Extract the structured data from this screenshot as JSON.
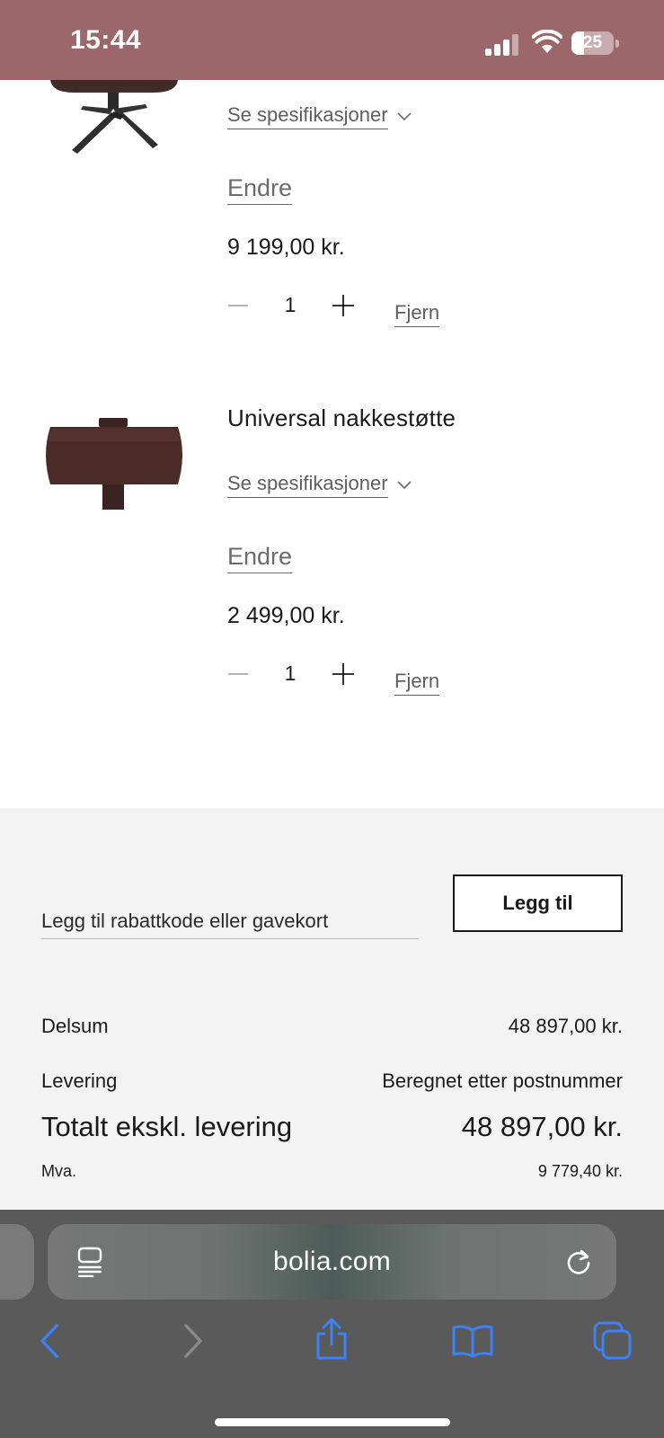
{
  "status_bar": {
    "time": "15:44",
    "battery_level": "25",
    "background_color": "#9b676a"
  },
  "cart": {
    "items": [
      {
        "name": "",
        "spec_label": "Se spesifikasjoner",
        "edit_label": "Endre",
        "price": "9 199,00 kr.",
        "quantity": "1",
        "remove_label": "Fjern",
        "image_icon": "swivel-chair-base-icon"
      },
      {
        "name": "Universal nakkestøtte",
        "spec_label": "Se spesifikasjoner",
        "edit_label": "Endre",
        "price": "2 499,00 kr.",
        "quantity": "1",
        "remove_label": "Fjern",
        "image_icon": "headrest-icon"
      }
    ]
  },
  "summary": {
    "discount_placeholder": "Legg til rabattkode eller gavekort",
    "apply_label": "Legg til",
    "subtotal_label": "Delsum",
    "subtotal_value": "48 897,00 kr.",
    "shipping_label": "Levering",
    "shipping_value": "Beregnet etter postnummer",
    "total_label": "Totalt ekskl. levering",
    "total_value": "48 897,00 kr.",
    "vat_label": "Mva.",
    "vat_value": "9 779,40 kr."
  },
  "browser": {
    "url": "bolia.com",
    "accent_color": "#3b82f6"
  }
}
